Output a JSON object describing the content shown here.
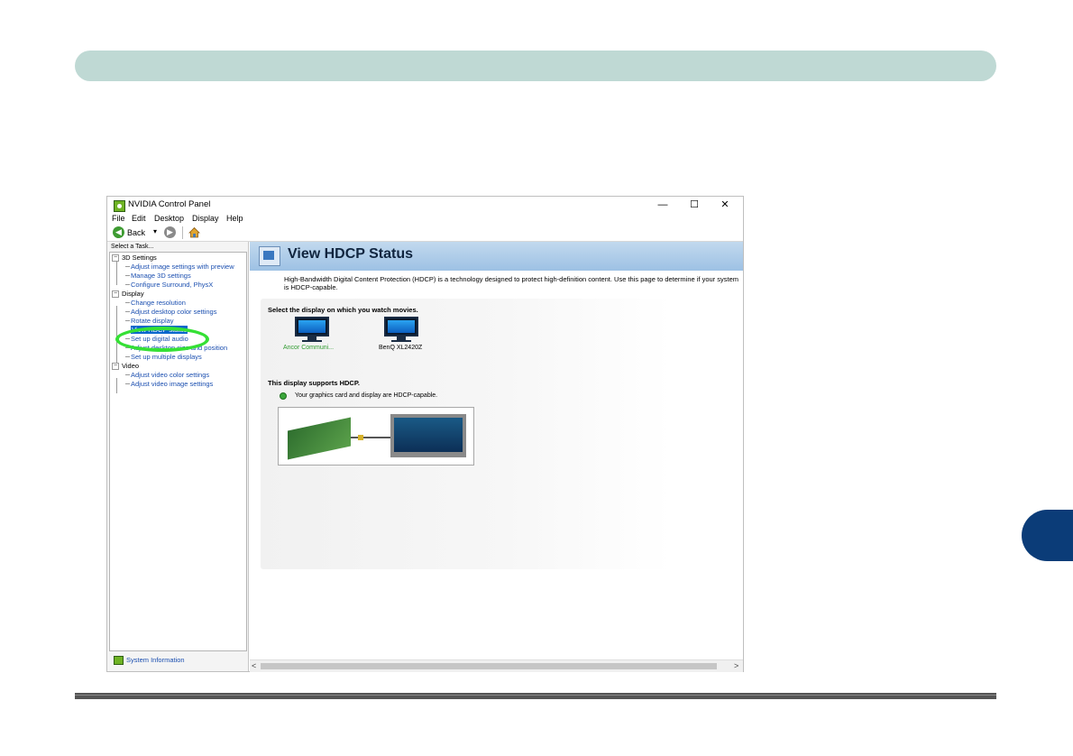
{
  "window": {
    "title": "NVIDIA Control Panel",
    "minimize": "—",
    "maximize": "☐",
    "close": "✕"
  },
  "menu": [
    {
      "label": "File"
    },
    {
      "label": "Edit"
    },
    {
      "label": "Desktop"
    },
    {
      "label": "Display"
    },
    {
      "label": "Help"
    }
  ],
  "toolbar": {
    "back_label": "Back",
    "back_icon": "◀",
    "forward_icon": "▶",
    "dropdown_icon": "▾"
  },
  "sidebar": {
    "header": "Select a Task...",
    "categories": [
      {
        "label": "3D Settings",
        "items": [
          "Adjust image settings with preview",
          "Manage 3D settings",
          "Configure Surround, PhysX"
        ]
      },
      {
        "label": "Display",
        "items": [
          "Change resolution",
          "Adjust desktop color settings",
          "Rotate display",
          "View HDCP status",
          "Set up digital audio",
          "Adjust desktop size and position",
          "Set up multiple displays"
        ]
      },
      {
        "label": "Video",
        "items": [
          "Adjust video color settings",
          "Adjust video image settings"
        ]
      }
    ],
    "selected_item": "View HDCP status",
    "system_info": "System Information"
  },
  "main": {
    "page_title": "View HDCP Status",
    "description": "High-Bandwidth Digital Content Protection (HDCP) is a technology designed to protect high-definition content. Use this page to determine if your system is HDCP-capable.",
    "select_prompt": "Select the display on which you watch movies.",
    "displays": [
      {
        "label": "Ancor Communi...",
        "active": true
      },
      {
        "label": "BenQ XL2420Z",
        "active": false
      }
    ],
    "support_heading": "This display supports HDCP.",
    "support_detail": "Your graphics card and display are HDCP-capable."
  },
  "scrollbar": {
    "left_arrow": "<",
    "right_arrow": ">"
  },
  "colors": {
    "header_band": "#bfd9d4",
    "chapter_tab": "#0b3c78",
    "link_blue": "#1b4fb0",
    "highlight_green": "#35e035",
    "nvidia_green": "#6fb324"
  }
}
